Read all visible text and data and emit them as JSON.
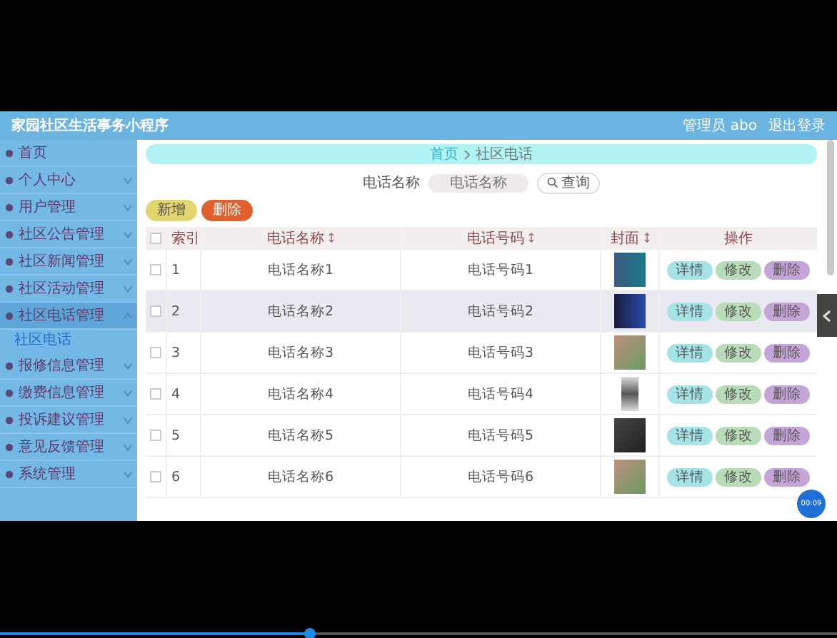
{
  "app": {
    "title": "家园社区生活事务小程序",
    "user": "管理员 abo",
    "logout": "退出登录"
  },
  "sidebar": {
    "items": [
      {
        "label": "首页"
      },
      {
        "label": "个人中心",
        "expanded": false
      },
      {
        "label": "用户管理",
        "expanded": false
      },
      {
        "label": "社区公告管理",
        "expanded": false
      },
      {
        "label": "社区新闻管理",
        "expanded": false
      },
      {
        "label": "社区活动管理",
        "expanded": false
      },
      {
        "label": "社区电话管理",
        "expanded": true,
        "children": [
          {
            "label": "社区电话",
            "selected": true
          }
        ]
      },
      {
        "label": "报修信息管理",
        "expanded": false
      },
      {
        "label": "缴费信息管理",
        "expanded": false
      },
      {
        "label": "投诉建议管理",
        "expanded": false
      },
      {
        "label": "意见反馈管理",
        "expanded": false
      },
      {
        "label": "系统管理",
        "expanded": false
      }
    ]
  },
  "breadcrumb": [
    "首页",
    "社区电话"
  ],
  "search": {
    "label": "电话名称",
    "placeholder": "电话名称",
    "button": "查询"
  },
  "actions": [
    {
      "kind": "add",
      "label": "新增"
    },
    {
      "kind": "delete",
      "label": "删除"
    }
  ],
  "table": {
    "all_checked": false,
    "columns": [
      "索引",
      "电话名称",
      "电话号码",
      "封面",
      "操作"
    ],
    "rows": [
      {
        "checked": false,
        "selected": false,
        "index": "1",
        "name": "电话名称1",
        "number": "电话号码1",
        "row_actions": [
          "详情",
          "修改",
          "删除"
        ]
      },
      {
        "checked": false,
        "selected": true,
        "index": "2",
        "name": "电话名称2",
        "number": "电话号码2",
        "row_actions": [
          "详情",
          "修改",
          "删除"
        ]
      },
      {
        "checked": false,
        "selected": false,
        "index": "3",
        "name": "电话名称3",
        "number": "电话号码3",
        "row_actions": [
          "详情",
          "修改",
          "删除"
        ]
      },
      {
        "checked": false,
        "selected": false,
        "index": "4",
        "name": "电话名称4",
        "number": "电话号码4",
        "row_actions": [
          "详情",
          "修改",
          "删除"
        ]
      },
      {
        "checked": false,
        "selected": false,
        "index": "5",
        "name": "电话名称5",
        "number": "电话号码5",
        "row_actions": [
          "详情",
          "修改",
          "删除"
        ]
      },
      {
        "checked": false,
        "selected": false,
        "index": "6",
        "name": "电话名称6",
        "number": "电话号码6",
        "row_actions": [
          "详情",
          "修改",
          "删除"
        ]
      }
    ]
  },
  "floating_badge": "00:09",
  "player": {
    "level": 0.37
  }
}
